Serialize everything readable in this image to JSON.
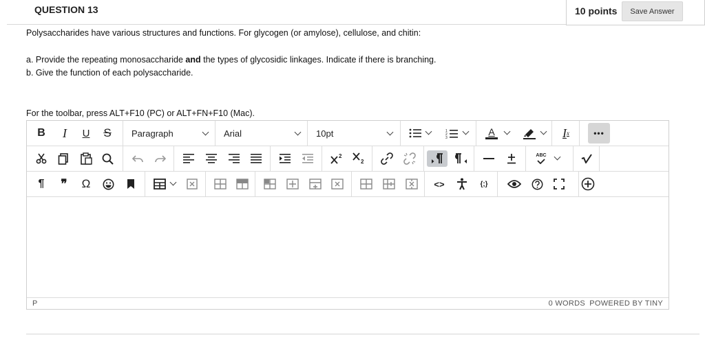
{
  "question": {
    "title": "QUESTION 13",
    "points": "10 points",
    "save_label": "Save Answer",
    "prompt": "Polysaccharides have various structures and functions.  For glycogen (or amylose), cellulose, and chitin:",
    "part_a_prefix": "a.  Provide the repeating monosaccharide ",
    "part_a_bold": "and",
    "part_a_suffix": " the types of glycosidic linkages.  Indicate if there is branching.",
    "part_b": "b.  Give the function of each polysaccharide."
  },
  "editor": {
    "toolbar_hint": "For the toolbar, press ALT+F10 (PC) or ALT+FN+F10 (Mac).",
    "block_format": "Paragraph",
    "font_family": "Arial",
    "font_size": "10pt",
    "more_label": "•••",
    "status_path": "P",
    "word_count": "0 WORDS",
    "powered_by": "POWERED BY TINY",
    "glyphs": {
      "bold": "B",
      "italic": "I",
      "underline": "U",
      "strike": "S",
      "font_color": "A",
      "pilcrow": "¶",
      "quote": "❞",
      "omega": "Ω",
      "code": "<>",
      "cmark_text": "{;}",
      "spell": "ABC",
      "clear_format": "I",
      "clear_sub": "x"
    }
  }
}
